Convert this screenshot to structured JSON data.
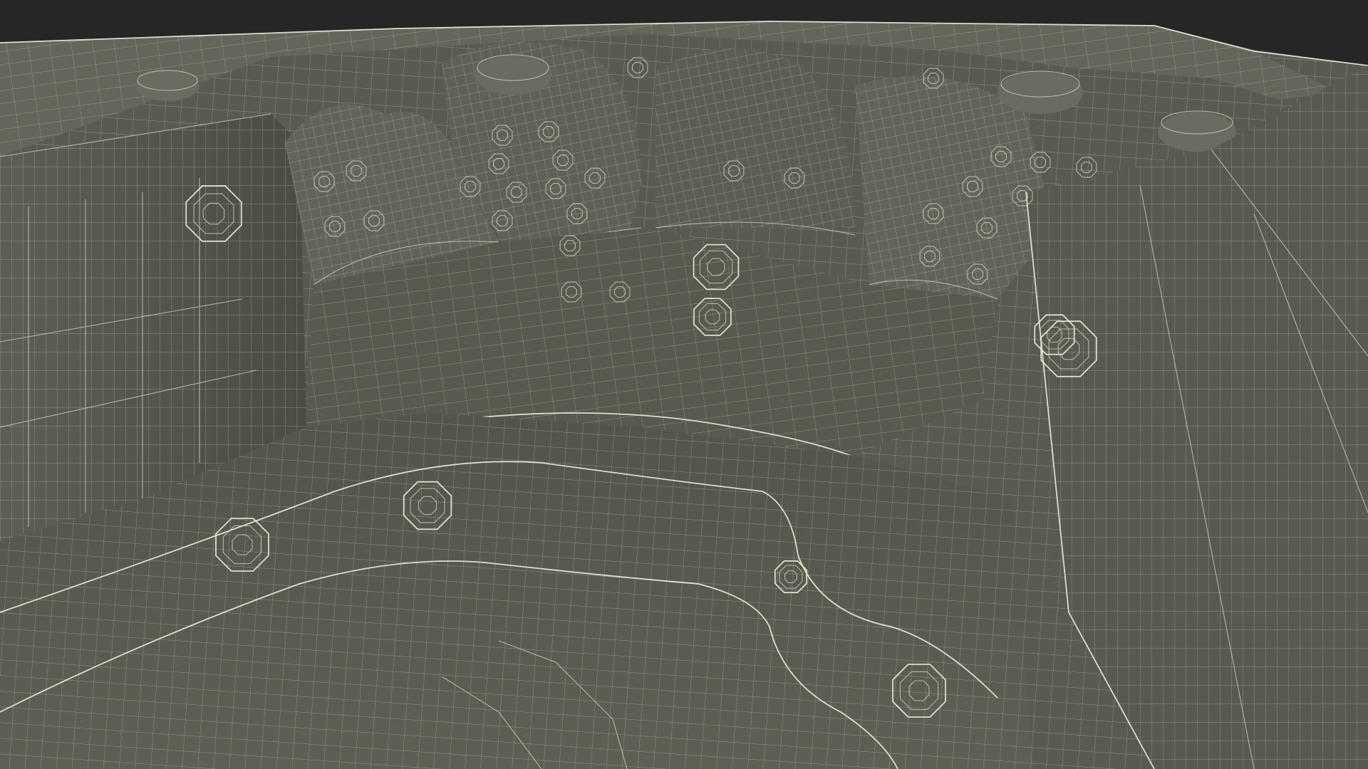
{
  "scene": {
    "subject": "hot-tub-wireframe",
    "colors": {
      "background": "#262626",
      "surface": "#5a5b52",
      "surface_dark": "#45463f",
      "surface_light": "#6b6c62",
      "wire": "#d9d9c4"
    },
    "jet_counts": {
      "large_wall_jets": 9,
      "small_backrest_jets": 30
    }
  }
}
